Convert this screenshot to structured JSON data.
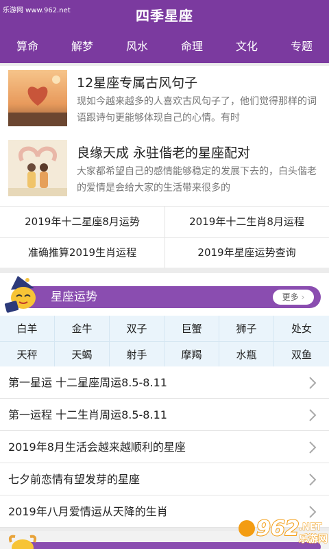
{
  "watermark": "乐游网 www.962.net",
  "app": {
    "title": "四季星座"
  },
  "nav": [
    "算命",
    "解梦",
    "风水",
    "命理",
    "文化",
    "专题"
  ],
  "articles": [
    {
      "title": "12星座专属古风句子",
      "desc": "现如今越来越多的人喜欢古风句子了，他们觉得那样的词语跟诗句更能够体现自己的心情。有时"
    },
    {
      "title": "良缘天成 永驻偕老的星座配对",
      "desc": "大家都希望自己的感情能够稳定的发展下去的，白头偕老的爱情是会给大家的生活带来很多的"
    }
  ],
  "links": [
    "2019年十二星座8月运势",
    "2019年十二生肖8月运程",
    "准确推算2019生肖运程",
    "2019年星座运势查询"
  ],
  "section": {
    "title": "星座运势",
    "more": "更多"
  },
  "zodiac": [
    "白羊",
    "金牛",
    "双子",
    "巨蟹",
    "狮子",
    "处女",
    "天秤",
    "天蝎",
    "射手",
    "摩羯",
    "水瓶",
    "双鱼"
  ],
  "list": [
    "第一星运 十二星座周运8.5-8.11",
    "第一运程 十二生肖周运8.5-8.11",
    "2019年8月生活会越来越顺利的星座",
    "七夕前恋情有望发芽的星座",
    "2019年八月爱情运从天降的生肖"
  ],
  "brand": {
    "number": "962",
    "tld": ".NET",
    "name": "乐游网"
  },
  "colors": {
    "primary": "#7b3a9f",
    "section": "#8a4db0",
    "zodiac_bg": "#eaf4fb"
  }
}
